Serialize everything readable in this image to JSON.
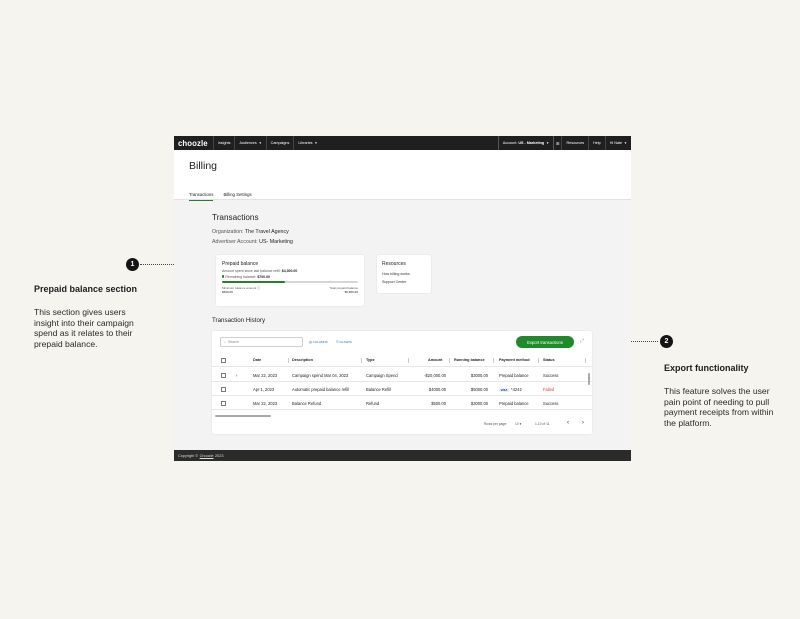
{
  "annotations": {
    "left": {
      "number": "1",
      "title": "Prepaid balance section",
      "text": "This section gives users insight into their campaign spend as it relates to their prepaid balance."
    },
    "right": {
      "number": "2",
      "title": "Export functionality",
      "text": "This feature solves the user pain point of needing to pull payment receipts from within the platform."
    }
  },
  "nav": {
    "logo": "choozle",
    "items": [
      "Insights",
      "Audiences",
      "Campaigns",
      "Libraries"
    ],
    "account_prefix": "Account:",
    "account_name": "US - Marketing",
    "right_items": [
      "Resources",
      "Help",
      "Hi Nate"
    ]
  },
  "header": {
    "title": "Billing",
    "tabs": [
      "Transactions",
      "Billing Settings"
    ]
  },
  "transactions": {
    "title": "Transactions",
    "org_label": "Organization:",
    "org_value": "The Travel Agency",
    "adv_label": "Advertiser Account:",
    "adv_value": "US- Marketing"
  },
  "prepaid": {
    "title": "Prepaid balance",
    "spent_label": "Amount spent since last balance refill:",
    "spent_value": "$4,300.00",
    "remaining_label": "Remaining balance:",
    "remaining_value": "$700.00",
    "progress_fraction": 0.46,
    "min_label": "Minimum balance amount",
    "min_value": "$500.00",
    "total_label": "Total prepaid balance",
    "total_value": "$5,000.00"
  },
  "resources": {
    "title": "Resources",
    "links": [
      "How billing works",
      "Support Center"
    ]
  },
  "history": {
    "title": "Transaction History",
    "search_placeholder": "Search",
    "columns_label": "COLUMNS",
    "filters_label": "FILTERS",
    "export_label": "Export transactions",
    "headers": [
      "Date",
      "Description",
      "Type",
      "Amount",
      "Running balance",
      "Payment method",
      "Status"
    ],
    "rows": [
      {
        "date": "Mar 22, 2023",
        "description": "Campaign spend Mar 04, 2023",
        "type": "Campaign Spend",
        "amount": "-$20,000.00",
        "running": "$3000.00",
        "method": "Prepaid balance",
        "status": "Success"
      },
      {
        "date": "Apr 1, 2023",
        "description": "Automatic prepaid balance refill",
        "type": "Balance Refill",
        "amount": "$4000.00",
        "running": "$5000.00",
        "method_card": "VISA",
        "method": "*4242",
        "status": "Failed"
      },
      {
        "date": "Mar 22, 2023",
        "description": "Balance Refund",
        "type": "Refund",
        "amount": "$500.00",
        "running": "$3000.00",
        "method": "Prepaid balance",
        "status": "Success"
      }
    ],
    "rows_per_page_label": "Rows per page:",
    "rows_per_page": "10",
    "range": "1-10 of 11"
  },
  "footer": {
    "prefix": "Copyright ©",
    "brand": "Choozle",
    "year": "2023"
  },
  "colors": {
    "accent_green": "#1f8a2a",
    "failed_red": "#d23c3c",
    "nav_dark": "#1f1f1f"
  }
}
